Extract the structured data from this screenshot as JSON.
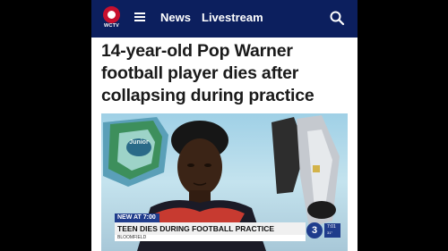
{
  "navbar": {
    "logo_text": "WCTV",
    "links": [
      "News",
      "Livestream"
    ]
  },
  "article": {
    "headline": "14-year-old Pop Warner football player dies after collapsing during practice"
  },
  "video": {
    "lower_third": {
      "tag": "NEW AT 7:00",
      "headline": "TEEN DIES DURING FOOTBALL PRACTICE",
      "location": "BLOOMFIELD",
      "channel_number": "3",
      "time": "7:01",
      "temperature": "31°"
    },
    "banner_text": "Junior"
  },
  "colors": {
    "navbar_bg": "#0c1f5e",
    "brand_red": "#c8102e",
    "lower_third_blue": "#1f3c8c"
  }
}
